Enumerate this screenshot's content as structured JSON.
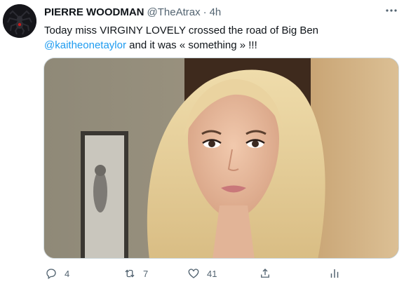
{
  "tweet": {
    "author_name": "PIERRE WOODMAN",
    "author_handle": "@TheAtrax",
    "separator": "·",
    "time": "4h",
    "text_line1": "Today miss VIRGINY LOVELY crossed the road of Big Ben",
    "mention": "@kaitheonetaylor",
    "text_line2_rest": " and it was « something » !!!"
  },
  "actions": {
    "reply_count": "4",
    "retweet_count": "7",
    "like_count": "41"
  },
  "icons": {
    "avatar": "spider-logo",
    "more": "more-horizontal-icon",
    "reply": "reply-icon",
    "retweet": "retweet-icon",
    "like": "heart-icon",
    "share": "share-icon",
    "analytics": "analytics-icon"
  },
  "colors": {
    "link": "#1d9bf0",
    "muted": "#536471",
    "text": "#0f1419",
    "border": "#cfd9de"
  }
}
